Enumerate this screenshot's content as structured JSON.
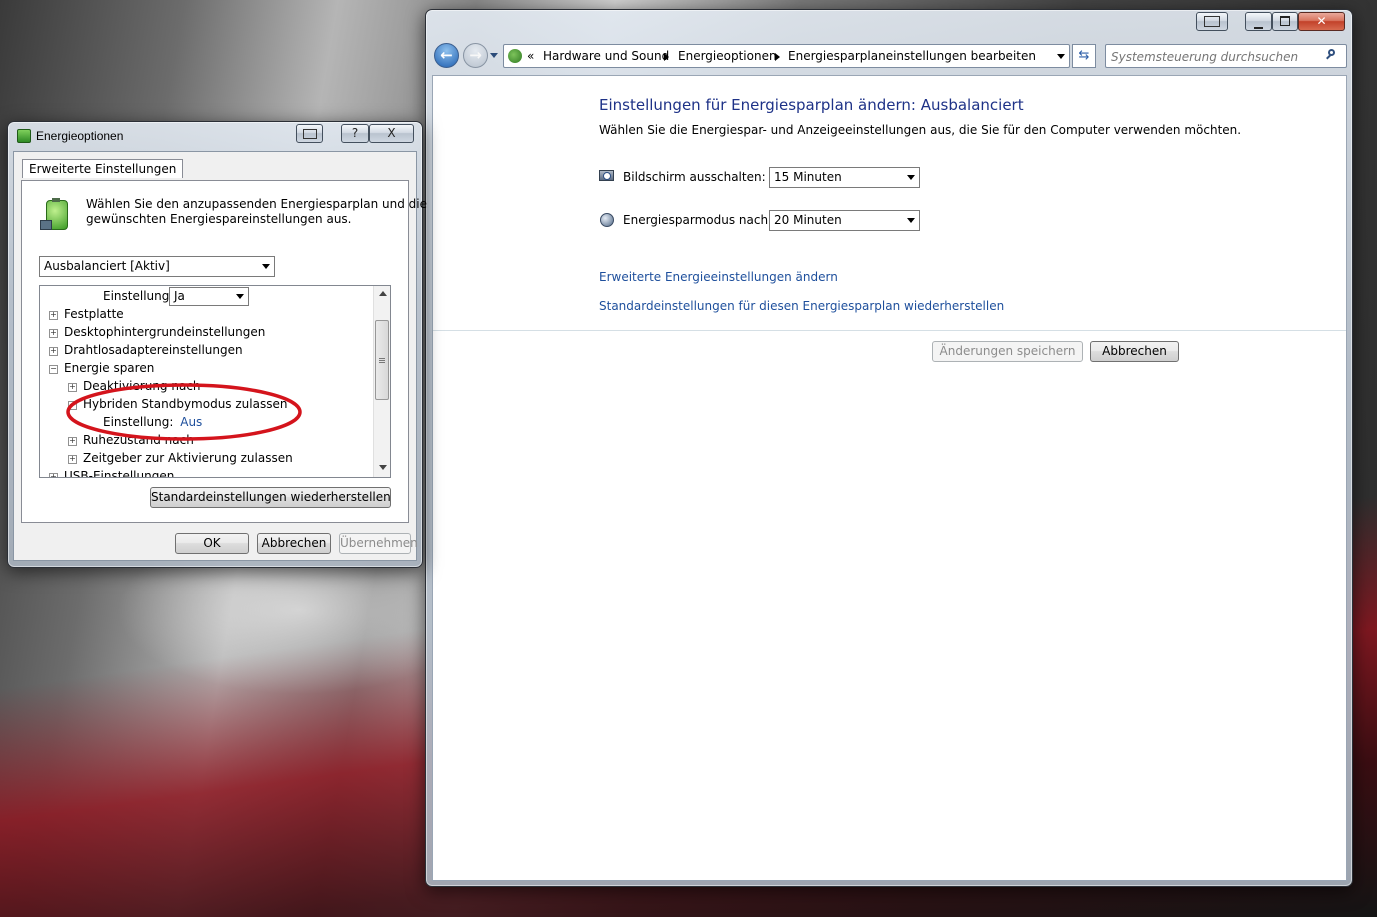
{
  "dialog": {
    "title": "Energieoptionen",
    "tab_label": "Erweiterte Einstellungen",
    "intro_text_line1": "Wählen Sie den anzupassenden Energiesparplan und die",
    "intro_text_line2": "gewünschten Energiespareinstellungen aus.",
    "plan_select_value": "Ausbalanciert [Aktiv]",
    "tree": {
      "top_setting_label": "Einstellung:",
      "top_setting_value": "Ja",
      "items": [
        {
          "label": "Festplatte",
          "expander": "+"
        },
        {
          "label": "Desktophintergrundeinstellungen",
          "expander": "+"
        },
        {
          "label": "Drahtlosadaptereinstellungen",
          "expander": "+"
        },
        {
          "label": "Energie sparen",
          "expander": "−"
        }
      ],
      "sub_items": [
        {
          "label": "Deaktivierung nach",
          "expander": "+"
        },
        {
          "label": "Hybriden Standbymodus zulassen",
          "expander": "−"
        }
      ],
      "hybrid_setting_label": "Einstellung:",
      "hybrid_setting_value": "Aus",
      "sub_items_after": [
        {
          "label": "Ruhezustand nach",
          "expander": "+"
        },
        {
          "label": "Zeitgeber zur Aktivierung zulassen",
          "expander": "+"
        }
      ],
      "last_item": {
        "label": "USB-Einstellungen",
        "expander": "+"
      }
    },
    "restore_defaults_label": "Standardeinstellungen wiederherstellen",
    "ok_label": "OK",
    "cancel_label": "Abbrechen",
    "apply_label": "Übernehmen",
    "caption_help": "?",
    "caption_close": "X"
  },
  "control_panel": {
    "breadcrumb": {
      "prefix": "«",
      "items": [
        "Hardware und Sound",
        "Energieoptionen",
        "Energiesparplaneinstellungen bearbeiten"
      ]
    },
    "search_placeholder": "Systemsteuerung durchsuchen",
    "heading": "Einstellungen für Energiesparplan ändern: Ausbalanciert",
    "subtitle": "Wählen Sie die Energiespar- und Anzeigeeinstellungen aus, die Sie für den Computer verwenden möchten.",
    "display_off_label": "Bildschirm ausschalten:",
    "display_off_value": "15 Minuten",
    "sleep_label": "Energiesparmodus nach:",
    "sleep_value": "20 Minuten",
    "advanced_link": "Erweiterte Energieeinstellungen ändern",
    "restore_link": "Standardeinstellungen für diesen Energiesparplan wiederherstellen",
    "save_label": "Änderungen speichern",
    "cancel_label": "Abbrechen"
  },
  "colors": {
    "link": "#1e4f9c",
    "heading": "#1e3287",
    "annotation_circle": "#d4141c"
  }
}
